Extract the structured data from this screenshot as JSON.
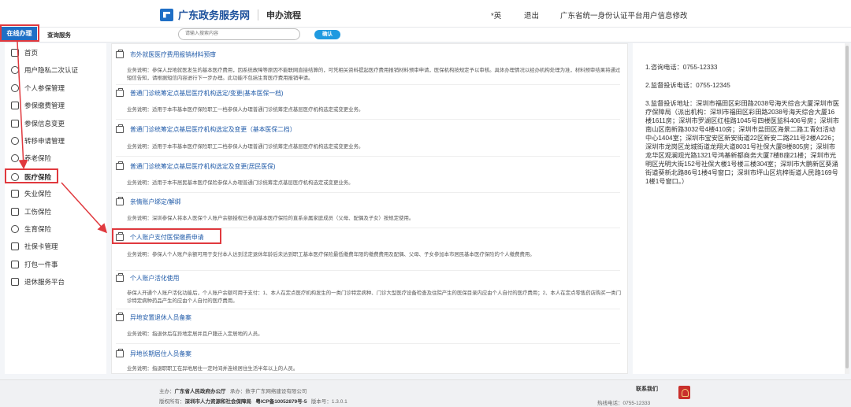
{
  "header": {
    "logo_text": "广东政务服务网",
    "section": "申办流程",
    "links": [
      "*英",
      "退出",
      "广东省统一身份认证平台用户信息修改"
    ]
  },
  "subbar": {
    "tab_online": "在线办理",
    "tab_query": "查询服务",
    "search_placeholder": "请输入搜索内容",
    "search_button": "确认"
  },
  "sidebar": {
    "items": [
      {
        "label": "首页",
        "icon": "home-icon"
      },
      {
        "label": "用户隐私二次认证",
        "icon": "user-verify-icon"
      },
      {
        "label": "个人参保管理",
        "icon": "person-icon"
      },
      {
        "label": "参保缴费管理",
        "icon": "payment-icon"
      },
      {
        "label": "参保信息变更",
        "icon": "edit-icon"
      },
      {
        "label": "转移申请管理",
        "icon": "transfer-icon"
      },
      {
        "label": "养老保险",
        "icon": "pension-icon"
      },
      {
        "label": "医疗保险",
        "icon": "medical-icon"
      },
      {
        "label": "失业保险",
        "icon": "unemployment-icon"
      },
      {
        "label": "工伤保险",
        "icon": "injury-icon"
      },
      {
        "label": "生育保险",
        "icon": "maternity-icon"
      },
      {
        "label": "社保卡管理",
        "icon": "card-icon"
      },
      {
        "label": "打包一件事",
        "icon": "package-icon"
      },
      {
        "label": "退休服务平台",
        "icon": "retire-icon"
      }
    ]
  },
  "services": [
    {
      "title": "市外就医医疗费用报销材料预审",
      "desc": "业务说明：参保人异地就医发生的基本医疗费用，因系统故障等原因不能联网直接结算的，可凭相关资料提起医疗费用报销材料预审申请，医保机构按规定予以审核。具体办理情况以经办机构处理为准，材料预审结果将通过短信告知，请根据短信内容进行下一步办理。此功能不包括生育医疗费用报销申请。"
    },
    {
      "title": "普通门诊统筹定点基层医疗机构选定/变更(基本医保一档)",
      "desc": "业务说明：适用于本市基本医疗保险职工一档参保人办理普通门诊统筹定点基层医疗机构选定或变更业务。"
    },
    {
      "title": "普通门诊统筹定点基层医疗机构选定及变更（基本医保二档）",
      "desc": "业务说明：适用于本市基本医疗保险职工二档参保人办理普通门诊统筹定点基层医疗机构选定或变更业务。"
    },
    {
      "title": "普通门诊统筹定点基层医疗机构选定及变更(居民医保)",
      "desc": "业务说明：适用于本市居民基本医疗保险参保人办理普通门诊统筹定点基层医疗机构选定或变更业务。"
    },
    {
      "title": "亲情账户绑定/解绑",
      "desc": "业务说明：深圳参保人将本人医保个人账户余额授权已参加基本医疗保险的直系亲属家庭成员（父母、配偶及子女）按规定使用。"
    },
    {
      "title": "个人账户支付医保缴费申请",
      "desc": "业务说明：参保人个人账户余额可用于支付本人达到法定退休年龄后未达到职工基本医疗保险最低缴费年限的缴费费用及配偶、父母、子女参加本市居民基本医疗保险的个人缴费费用。"
    },
    {
      "title": "个人账户活化使用",
      "desc": "参保人开通个人账户活化功能后，个人账户余额可用于支付：1、本人在定点医疗机构发生的一类门诊特定病种、门诊大型医疗设备检查及住院产生的医保目录内应由个人自付的医疗费用；2、本人在定点零售药店购买一类门诊特定病种药品产生的应由个人自付的医疗费用。"
    },
    {
      "title": "异地安置退休人员备案",
      "desc": "业务说明：指退休后在异地定居并且户籍迁入定居地的人员。"
    },
    {
      "title": "异地长期居住人员备案",
      "desc": "业务说明：指退职职工在异地居住一定时间并连续居住生活半年以上的人员。"
    }
  ],
  "right": {
    "consult": "1.咨询电话：0755-12333",
    "supervise": "2.监督投诉电话：0755-12345",
    "address": "3.监督投诉地址：深圳市福田区彩田路2038号海天综合大厦深圳市医疗保障局（派出机构：深圳市福田区彩田路2038号海天综合大厦16楼1611房；深圳市罗湖区红桂路1045号四楼医监科406号房；深圳市南山区南新路3032号4楼410房；深圳市盐田区海景二路工青妇活动中心1404室；深圳市宝安区新安街道22区新安二路211号2楼A226；深圳市龙岗区龙城街道龙翔大道8031号社保大厦8楼805房；深圳市龙华区观澜观光路1321号鸿基新都商务大厦7楼B座21楼；深圳市光明区光明大街152号社保大楼1号楼三楼304室；深圳市大鹏新区葵涌街道葵新北路86号1楼4号窗口；深圳市坪山区坑梓街道人民路169号1楼1号窗口。）"
  },
  "footer": {
    "host_label": "主办：",
    "host": "广东省人民政府办公厅",
    "undertake_label": "承办：",
    "undertake": "数字广东网络建设有限公司",
    "owner_label": "版权所有：",
    "owner": "深圳市人力资源和社会保障局",
    "icp": "粤ICP备10052879号-5",
    "version_label": "版本号：",
    "version": "1.3.0.1",
    "contact": "联系我们",
    "hotline_label": "热线电话：",
    "hotline": "0755-12333"
  },
  "colors": {
    "brand": "#1f6fc6",
    "highlight": "#e0393e",
    "link": "#1f5aa8"
  }
}
